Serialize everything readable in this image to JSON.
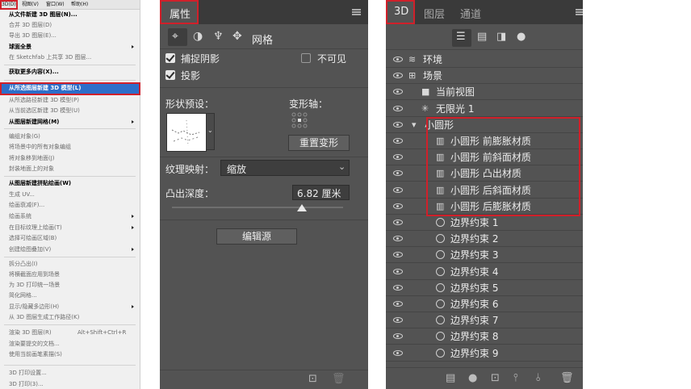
{
  "menu": {
    "bar": [
      "3D(D)",
      "视图(V)",
      "窗口(W)",
      "帮助(H)"
    ],
    "items": [
      {
        "label": "从文件新建 3D 图层(N)...",
        "style": "b"
      },
      {
        "label": "合并 3D 图层(D)",
        "style": "g"
      },
      {
        "label": "导出 3D 图层(E)...",
        "style": "g"
      },
      {
        "label": "球面全景",
        "style": "b",
        "sub": true
      },
      {
        "label": "在 Sketchfab 上共享 3D 图层...",
        "style": "g"
      },
      {
        "label": "获取更多内容(X)...",
        "style": "b"
      },
      {
        "label": "从所选图层新建 3D 模型(L)",
        "style": "w",
        "selected": true
      },
      {
        "label": "从所选路径新建 3D 模型(P)",
        "style": "g"
      },
      {
        "label": "从当前选区新建 3D 模型(U)",
        "style": "g"
      },
      {
        "label": "从图层新建网格(M)",
        "style": "b",
        "sub": true
      },
      {
        "label": "编组对象(G)",
        "style": "g"
      },
      {
        "label": "将场景中的所有对象编组",
        "style": "g"
      },
      {
        "label": "将对象移到地面(J)",
        "style": "g"
      },
      {
        "label": "封装地面上的对象",
        "style": "g"
      },
      {
        "label": "从图层新建拼贴绘画(W)",
        "style": "b"
      },
      {
        "label": "生成 UV...",
        "style": "g"
      },
      {
        "label": "绘画衰减(F)...",
        "style": "g"
      },
      {
        "label": "绘画系统",
        "style": "g",
        "sub": true
      },
      {
        "label": "在目标纹理上绘画(T)",
        "style": "g",
        "sub": true
      },
      {
        "label": "选择可绘画区域(B)",
        "style": "g"
      },
      {
        "label": "创建绘图叠加(V)",
        "style": "g",
        "sub": true
      },
      {
        "label": "拆分凸出(I)",
        "style": "g"
      },
      {
        "label": "将横截面应用到场景",
        "style": "g"
      },
      {
        "label": "为 3D 打印统一场景",
        "style": "g"
      },
      {
        "label": "简化网格...",
        "style": "g"
      },
      {
        "label": "显示/隐藏多边形(H)",
        "style": "g",
        "sub": true
      },
      {
        "label": "从 3D 图层生成工作路径(K)",
        "style": "g"
      },
      {
        "label": "渲染 3D 图层(R)",
        "style": "g",
        "shortcut": "Alt+Shift+Ctrl+R"
      },
      {
        "label": "渲染要提交的文档...",
        "style": "g"
      },
      {
        "label": "使用当前画笔素描(S)",
        "style": "g"
      },
      {
        "label": "3D 打印设置...",
        "style": "g"
      },
      {
        "label": "3D 打印(3)...",
        "style": "g"
      }
    ]
  },
  "props": {
    "tab": "属性",
    "tool_icons": [
      "scene-icon",
      "material-icon",
      "deform-icon",
      "coordinates-icon"
    ],
    "mesh_label": "网格",
    "catch_shadows": "捕捉阴影",
    "invisible": "不可见",
    "cast_shadows": "投影",
    "shape_preset": "形状预设：",
    "deform_axis": "变形轴：",
    "reset_deform": "重置变形",
    "texture_mapping": "纹理映射：",
    "texture_value": "缩放",
    "extrusion_depth": "凸出深度：",
    "depth_value": "6.82 厘米",
    "depth_fraction": 0.76,
    "edit_source": "编辑源"
  },
  "panel3d": {
    "tabs": [
      "3D",
      "图层",
      "通道"
    ],
    "rows": [
      {
        "icon": "environment-icon",
        "glyph": "≋",
        "label": "环境",
        "indent": 0
      },
      {
        "icon": "scene-icon",
        "glyph": "⊞",
        "label": "场景",
        "indent": 0
      },
      {
        "icon": "camera-icon",
        "glyph": "■",
        "label": "当前视图",
        "indent": 1
      },
      {
        "icon": "sun-icon",
        "glyph": "✳",
        "label": "无限光 1",
        "indent": 1
      },
      {
        "icon": "mesh-icon",
        "glyph": "▾",
        "label": "小圆形",
        "indent": 1
      },
      {
        "icon": "material-icon",
        "glyph": "▥",
        "label": "小圆形 前膨胀材质",
        "indent": 2
      },
      {
        "icon": "material-icon",
        "glyph": "▥",
        "label": "小圆形 前斜面材质",
        "indent": 2
      },
      {
        "icon": "material-icon",
        "glyph": "▥",
        "label": "小圆形 凸出材质",
        "indent": 2
      },
      {
        "icon": "material-icon",
        "glyph": "▥",
        "label": "小圆形 后斜面材质",
        "indent": 2
      },
      {
        "icon": "material-icon",
        "glyph": "▥",
        "label": "小圆形 后膨胀材质",
        "indent": 2
      },
      {
        "icon": "constraint-icon",
        "label": "边界约束 1",
        "indent": 2
      },
      {
        "icon": "constraint-icon",
        "label": "边界约束 2",
        "indent": 2
      },
      {
        "icon": "constraint-icon",
        "label": "边界约束 3",
        "indent": 2
      },
      {
        "icon": "constraint-icon",
        "label": "边界约束 4",
        "indent": 2
      },
      {
        "icon": "constraint-icon",
        "label": "边界约束 5",
        "indent": 2
      },
      {
        "icon": "constraint-icon",
        "label": "边界约束 6",
        "indent": 2
      },
      {
        "icon": "constraint-icon",
        "label": "边界约束 7",
        "indent": 2
      },
      {
        "icon": "constraint-icon",
        "label": "边界约束 8",
        "indent": 2
      },
      {
        "icon": "constraint-icon",
        "label": "边界约束 9",
        "indent": 2
      }
    ]
  },
  "colors": {
    "highlight": "#d0202a",
    "menu_selected": "#2d6ec9",
    "panel_bg": "#535353",
    "header_bg": "#3a3a3a"
  }
}
